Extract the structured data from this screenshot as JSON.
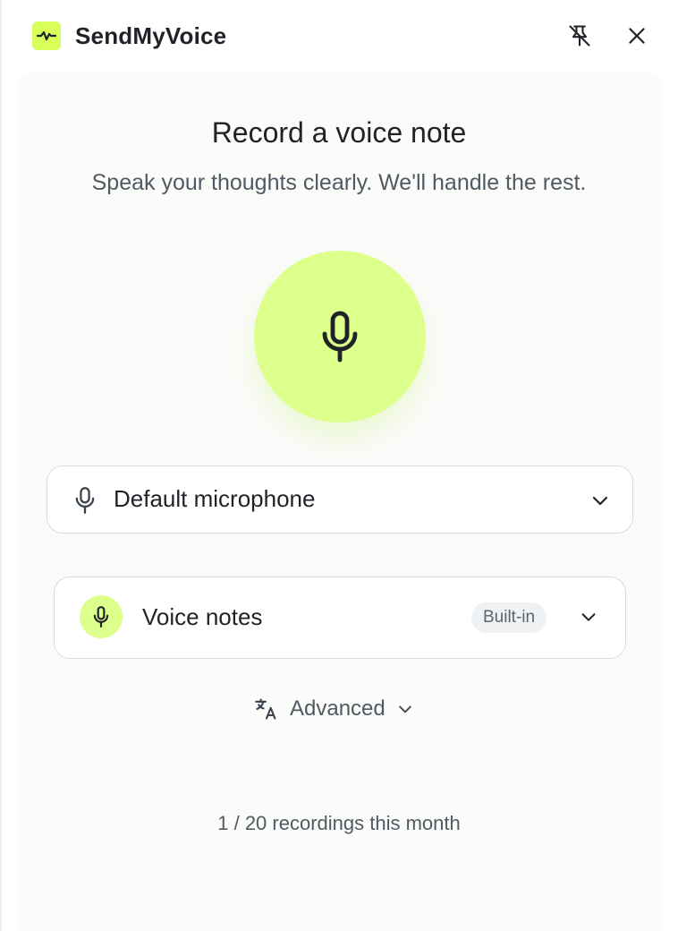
{
  "header": {
    "app_title": "SendMyVoice",
    "logo_icon": "waveform-icon",
    "pin_icon": "unpin-icon",
    "close_icon": "close-icon"
  },
  "main": {
    "title": "Record a voice note",
    "subtitle": "Speak your thoughts clearly. We'll handle the rest.",
    "record_button_icon": "microphone-icon",
    "microphone_select": {
      "selected": "Default microphone",
      "icon": "microphone-icon"
    },
    "mode_select": {
      "selected": "Voice notes",
      "badge": "Built-in",
      "icon": "microphone-icon"
    },
    "advanced": {
      "label": "Advanced",
      "icon": "translate-icon"
    },
    "usage": "1 / 20 recordings this month"
  },
  "colors": {
    "accent": "#ddff8c",
    "logo_bg": "#d8ff5a",
    "card_bg": "#fbfbfa",
    "text_primary": "#1f2328",
    "text_secondary": "#4f5a63"
  }
}
